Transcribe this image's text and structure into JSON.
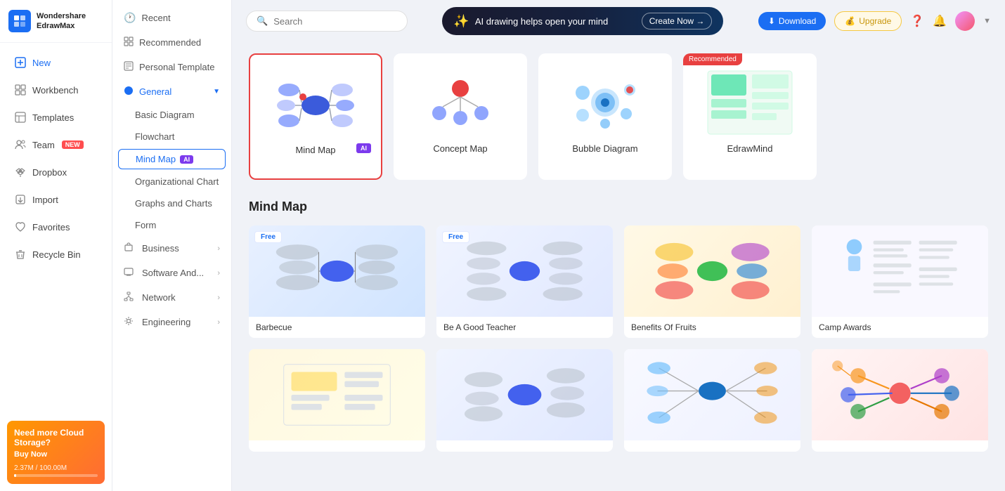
{
  "app": {
    "name": "Wondershare",
    "subname": "EdrawMax"
  },
  "sidebar": {
    "items": [
      {
        "id": "new",
        "label": "New",
        "icon": "➕"
      },
      {
        "id": "workbench",
        "label": "Workbench",
        "icon": "🗂"
      },
      {
        "id": "templates",
        "label": "Templates",
        "icon": "📋"
      },
      {
        "id": "team",
        "label": "Team",
        "icon": "👥",
        "badge": "NEW"
      },
      {
        "id": "dropbox",
        "label": "Dropbox",
        "icon": "📦"
      },
      {
        "id": "import",
        "label": "Import",
        "icon": "📥"
      },
      {
        "id": "favorites",
        "label": "Favorites",
        "icon": "❤"
      },
      {
        "id": "recycle",
        "label": "Recycle Bin",
        "icon": "🗑"
      }
    ],
    "cloud": {
      "title": "Need more Cloud Storage?",
      "buy_label": "Buy Now",
      "used": "2.37M",
      "total": "100.00M",
      "storage_text": "2.37M / 100.00M"
    }
  },
  "middle_panel": {
    "items": [
      {
        "id": "recent",
        "label": "Recent",
        "icon": "🕐"
      },
      {
        "id": "recommended",
        "label": "Recommended",
        "icon": "⭐"
      },
      {
        "id": "personal",
        "label": "Personal Template",
        "icon": "📄"
      }
    ],
    "general_section": {
      "label": "General",
      "sub_items": [
        {
          "id": "basic",
          "label": "Basic Diagram"
        },
        {
          "id": "flowchart",
          "label": "Flowchart"
        },
        {
          "id": "mindmap",
          "label": "Mind Map",
          "badge": "AI",
          "active": true
        },
        {
          "id": "org",
          "label": "Organizational Chart"
        },
        {
          "id": "graphs",
          "label": "Graphs and Charts"
        },
        {
          "id": "form",
          "label": "Form"
        }
      ]
    },
    "expandable_sections": [
      {
        "id": "business",
        "label": "Business"
      },
      {
        "id": "software",
        "label": "Software And..."
      },
      {
        "id": "network",
        "label": "Network"
      },
      {
        "id": "engineering",
        "label": "Engineering"
      }
    ]
  },
  "topbar": {
    "search_placeholder": "Search",
    "ai_banner_text": "AI drawing helps open your mind",
    "ai_banner_cta": "Create Now →",
    "download_label": "Download",
    "upgrade_label": "Upgrade"
  },
  "top_templates": [
    {
      "id": "mindmap",
      "label": "Mind Map",
      "badge": "AI",
      "selected": true
    },
    {
      "id": "concept",
      "label": "Concept Map",
      "selected": false
    },
    {
      "id": "bubble",
      "label": "Bubble Diagram",
      "selected": false
    },
    {
      "id": "edrawmind",
      "label": "EdrawMind",
      "recommended": true,
      "selected": false
    }
  ],
  "mind_map_section": {
    "title": "Mind Map",
    "templates": [
      {
        "id": "barbecue",
        "label": "Barbecue",
        "free": true,
        "color": "1"
      },
      {
        "id": "teacher",
        "label": "Be A Good Teacher",
        "free": true,
        "color": "2"
      },
      {
        "id": "fruits",
        "label": "Benefits Of Fruits",
        "free": false,
        "color": "3"
      },
      {
        "id": "camp",
        "label": "Camp Awards",
        "free": false,
        "color": "4"
      },
      {
        "id": "t5",
        "label": "",
        "free": false,
        "color": "5"
      },
      {
        "id": "t6",
        "label": "",
        "free": false,
        "color": "1"
      },
      {
        "id": "t7",
        "label": "",
        "free": false,
        "color": "2"
      },
      {
        "id": "t8",
        "label": "",
        "free": false,
        "color": "3"
      }
    ]
  }
}
